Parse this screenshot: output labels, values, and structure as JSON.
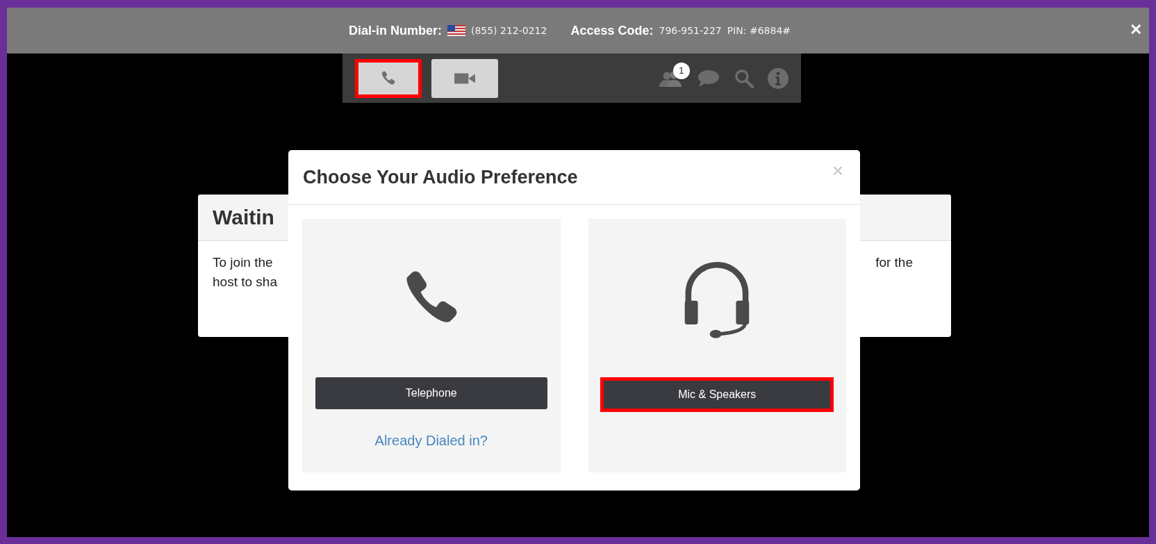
{
  "header_bar": {
    "dial_in_label": "Dial-in Number:",
    "dial_in_number": "(855) 212-0212",
    "access_code_label": "Access Code:",
    "access_code": "796-951-227",
    "pin": "PIN: #6884#",
    "close": "✕"
  },
  "toolbar": {
    "buttons": [
      {
        "kind": "phone",
        "highlighted": true
      },
      {
        "kind": "video",
        "highlighted": false
      }
    ],
    "icons": [
      {
        "kind": "participants",
        "badge": "1"
      },
      {
        "kind": "chat"
      },
      {
        "kind": "search"
      },
      {
        "kind": "info"
      }
    ]
  },
  "background_card": {
    "title": "Waitin",
    "body_lines": [
      "To join the",
      "host to sha"
    ],
    "body_right": "for the"
  },
  "dialog": {
    "title": "Choose Your Audio Preference",
    "close": "×",
    "options": [
      {
        "kind": "telephone",
        "button": "Telephone",
        "highlighted": false,
        "link": "Already Dialed in?"
      },
      {
        "kind": "headset",
        "button": "Mic & Speakers",
        "highlighted": true
      }
    ]
  }
}
